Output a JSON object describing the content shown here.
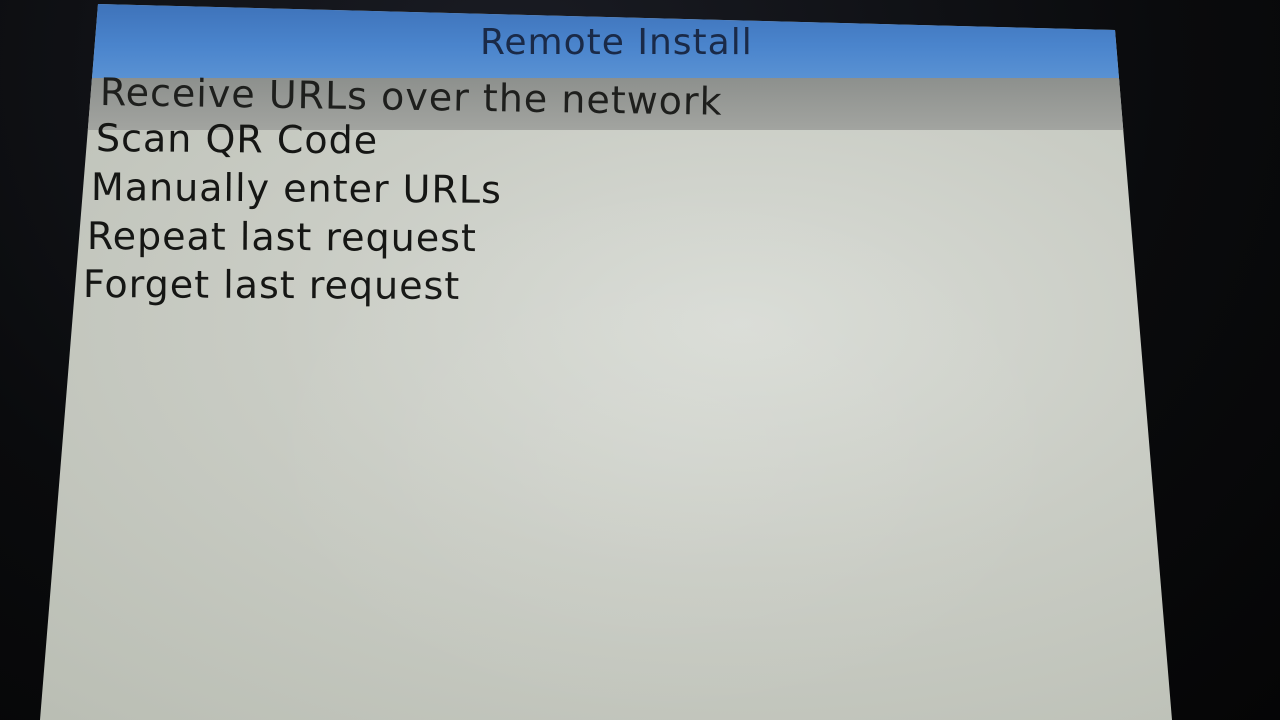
{
  "window": {
    "title": "Remote Install"
  },
  "menu": {
    "selected_index": 0,
    "items": [
      {
        "label": "Receive URLs over the network"
      },
      {
        "label": "Scan QR Code"
      },
      {
        "label": "Manually enter URLs"
      },
      {
        "label": "Repeat last request"
      },
      {
        "label": "Forget last request"
      }
    ]
  },
  "colors": {
    "title_bar": "#4a84cc",
    "selection": "#9a9c99",
    "background": "#c9ccc4",
    "text": "#151614"
  }
}
